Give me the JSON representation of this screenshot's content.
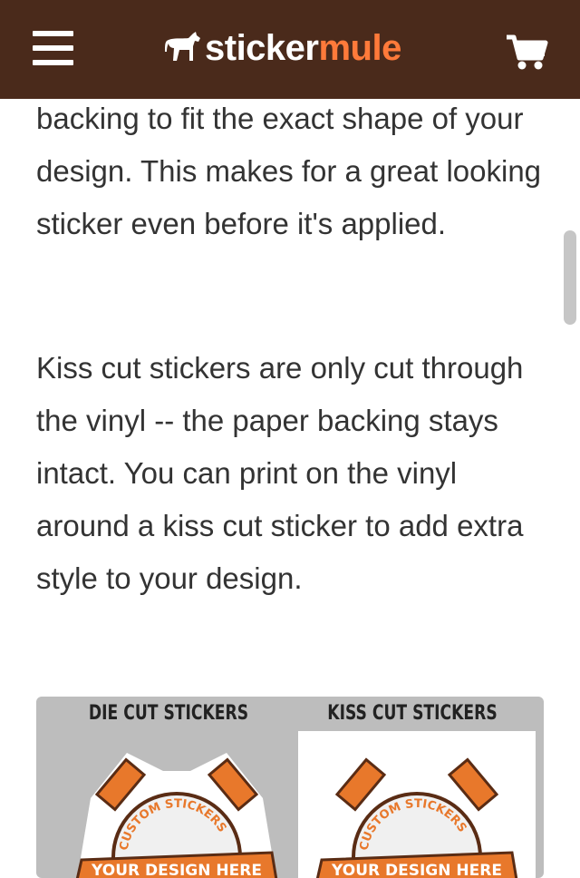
{
  "header": {
    "brand_part1": "sticker",
    "brand_part2": "mule",
    "menu_icon": "hamburger-menu-icon",
    "cart_icon": "cart-icon"
  },
  "colors": {
    "header_bg": "#4a2a1b",
    "brand_accent": "#ff7a3a",
    "text": "#333333"
  },
  "content": {
    "paragraph1": "backing to fit the exact shape of your design. This makes for a great looking sticker even before it's applied.",
    "paragraph2": "Kiss cut stickers are only cut through the vinyl -- the paper backing stays intact. You can print on the vinyl around a kiss cut sticker to add extra style to your design."
  },
  "comparison": {
    "die_cut_title": "DIE CUT STICKERS",
    "kiss_cut_title": "KISS CUT STICKERS",
    "badge_arc_text": "CUSTOM STICKERS",
    "badge_banner_text": "YOUR DESIGN HERE"
  }
}
